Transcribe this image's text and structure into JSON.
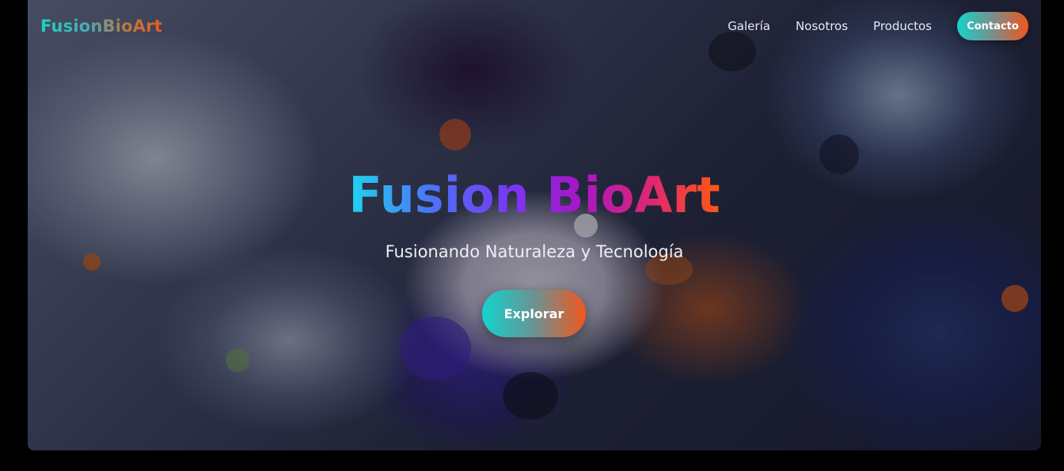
{
  "brand": {
    "logo_text": "FusionBioArt"
  },
  "nav": {
    "items": [
      {
        "label": "Galería"
      },
      {
        "label": "Nosotros"
      },
      {
        "label": "Productos"
      }
    ],
    "contact_label": "Contacto"
  },
  "hero": {
    "title": "Fusion BioArt",
    "subtitle": "Fusionando Naturaleza y Tecnología",
    "cta_label": "Explorar",
    "background_image": "abstract-fluid-paint-image"
  },
  "colors": {
    "accent_start": "#14d4cc",
    "accent_end": "#f0561c",
    "title_mid": "#7c34f2",
    "page_background": "#000000"
  }
}
